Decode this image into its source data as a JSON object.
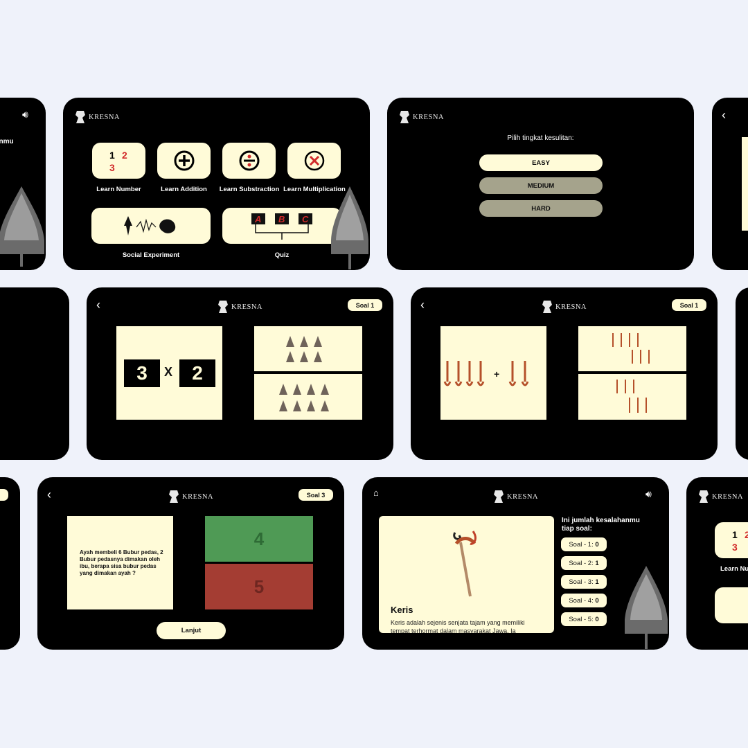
{
  "brand": "KRESNA",
  "menu": {
    "items": [
      "Learn Number",
      "Learn Addition",
      "Learn Substraction",
      "Learn Multiplication"
    ],
    "wide": [
      "Social Experiment",
      "Quiz"
    ],
    "number_icon": {
      "a": "1",
      "b": "2",
      "c": "3"
    },
    "quiz_letters": [
      "A",
      "B",
      "C"
    ]
  },
  "left_fragment": {
    "text": "anmu"
  },
  "difficulty": {
    "prompt": "Pilih tingkat kesulitan:",
    "options": [
      "EASY",
      "MEDIUM",
      "HARD"
    ],
    "selected": "EASY"
  },
  "mult_card": {
    "soal": "Soal 1",
    "left": "3",
    "op": "X",
    "right": "2"
  },
  "add_card": {
    "soal": "Soal 1",
    "op": "+"
  },
  "quiz_card": {
    "soal": "Soal 3",
    "question": "Ayah membeli 6 Bubur pedas, 2 Bubur pedasnya dimakan oleh ibu, berapa sisa bubur pedas yang dimakan ayah ?",
    "answers": [
      "4",
      "5"
    ],
    "answer_colors": [
      "#4f9a55",
      "#a43d33"
    ],
    "next": "Lanjut"
  },
  "keris_card": {
    "title": "Keris",
    "desc": "Keris adalah sejenis senjata tajam yang memiliki tempat terhormat dalam masyarakat Jawa. Ia",
    "mistakes_title": "Ini jumlah kesalahanmu tiap soal:",
    "mistakes": [
      {
        "label": "Soal - 1:",
        "value": "0"
      },
      {
        "label": "Soal - 2:",
        "value": "1"
      },
      {
        "label": "Soal - 3:",
        "value": "1"
      },
      {
        "label": "Soal - 4:",
        "value": "0"
      },
      {
        "label": "Soal - 5:",
        "value": "0"
      }
    ]
  },
  "right_fragment": {
    "n1": "1",
    "n2": "2",
    "n3": "3",
    "caption": "Learn Nu"
  },
  "colors": {
    "bg": "#eff2fa",
    "card": "#000000",
    "cream": "#fffbd8",
    "red": "#d12a2a",
    "gray": "#a5a38c"
  }
}
